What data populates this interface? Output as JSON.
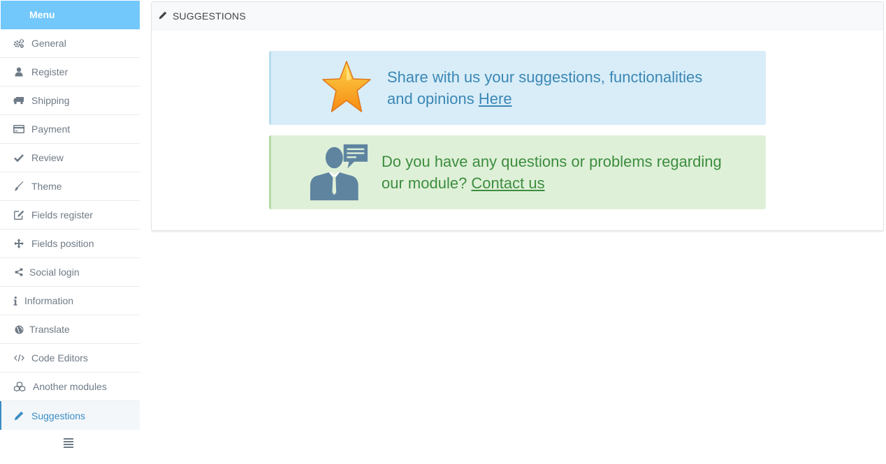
{
  "sidebar": {
    "header": "Menu",
    "items": [
      {
        "label": "General",
        "icon": "gears-icon"
      },
      {
        "label": "Register",
        "icon": "user-icon"
      },
      {
        "label": "Shipping",
        "icon": "truck-icon"
      },
      {
        "label": "Payment",
        "icon": "credit-card-icon"
      },
      {
        "label": "Review",
        "icon": "check-icon"
      },
      {
        "label": "Theme",
        "icon": "brush-icon"
      },
      {
        "label": "Fields register",
        "icon": "edit-icon"
      },
      {
        "label": "Fields position",
        "icon": "move-icon"
      },
      {
        "label": "Social login",
        "icon": "share-icon"
      },
      {
        "label": "Information",
        "icon": "info-icon"
      },
      {
        "label": "Translate",
        "icon": "globe-icon"
      },
      {
        "label": "Code Editors",
        "icon": "code-icon"
      },
      {
        "label": "Another modules",
        "icon": "cubes-icon"
      },
      {
        "label": "Suggestions",
        "icon": "pencil-icon",
        "active": true
      }
    ],
    "collapse_icon": "hamburger-icon"
  },
  "panel": {
    "title": "SUGGESTIONS",
    "title_icon": "pencil-icon",
    "suggest": {
      "line1": "Share with us your suggestions, functionalities",
      "line2_prefix": "and opinions ",
      "link": "Here",
      "icon": "star-icon"
    },
    "contact": {
      "line1": "Do you have any questions or problems regarding",
      "line2_prefix": "our module? ",
      "link": "Contact us",
      "icon": "support-agent-icon"
    }
  },
  "colors": {
    "menu_header": "#72c7fb",
    "active": "#3c8dc4",
    "info_bg": "#d8edf8",
    "info_text": "#3b87b5",
    "success_bg": "#dff0d8",
    "success_text": "#3c8d3f"
  }
}
